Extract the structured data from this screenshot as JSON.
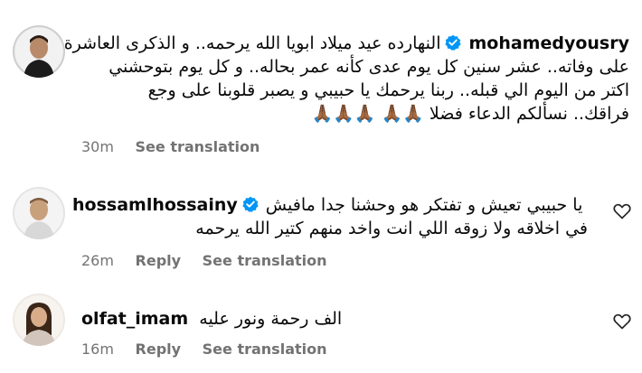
{
  "comments": [
    {
      "username": "mohamedyousry",
      "verified": true,
      "lines": [
        "النهارده عيد ميلاد ابويا الله يرحمه.. و الذكرى العاشرة",
        "على وفاته.. عشر سنين كل يوم عدى كأنه عمر بحاله.. و كل يوم بتوحشني",
        "اكتر من اليوم الي قبله.. ربنا يرحمك يا حبيبي و يصبر قلوبنا على وجع",
        "فراقك.. نسألكم الدعاء فضلا 🙏🏾🙏🏾 🙏🏾🙏🏾🙏🏾"
      ],
      "time": "30m",
      "actions": [
        "See translation"
      ],
      "show_heart": false
    },
    {
      "username": "hossamlhossainy",
      "verified": true,
      "lines": [
        "يا حبيبي تعيش و تفتكر هو وحشنا جدا مافيش",
        "في اخلاقه ولا زوقه اللي انت واخد منهم كتير الله يرحمه"
      ],
      "time": "26m",
      "actions": [
        "Reply",
        "See translation"
      ],
      "show_heart": true
    },
    {
      "username": "olfat_imam",
      "verified": false,
      "lines": [
        "الف رحمة ونور عليه"
      ],
      "time": "16m",
      "actions": [
        "Reply",
        "See translation"
      ],
      "show_heart": true
    }
  ],
  "colors": {
    "verified": "#0095f6",
    "meta": "#737373",
    "text": "#0a0a0a"
  },
  "icons": {
    "verified": "verified-badge-icon",
    "heart": "heart-outline-icon"
  }
}
